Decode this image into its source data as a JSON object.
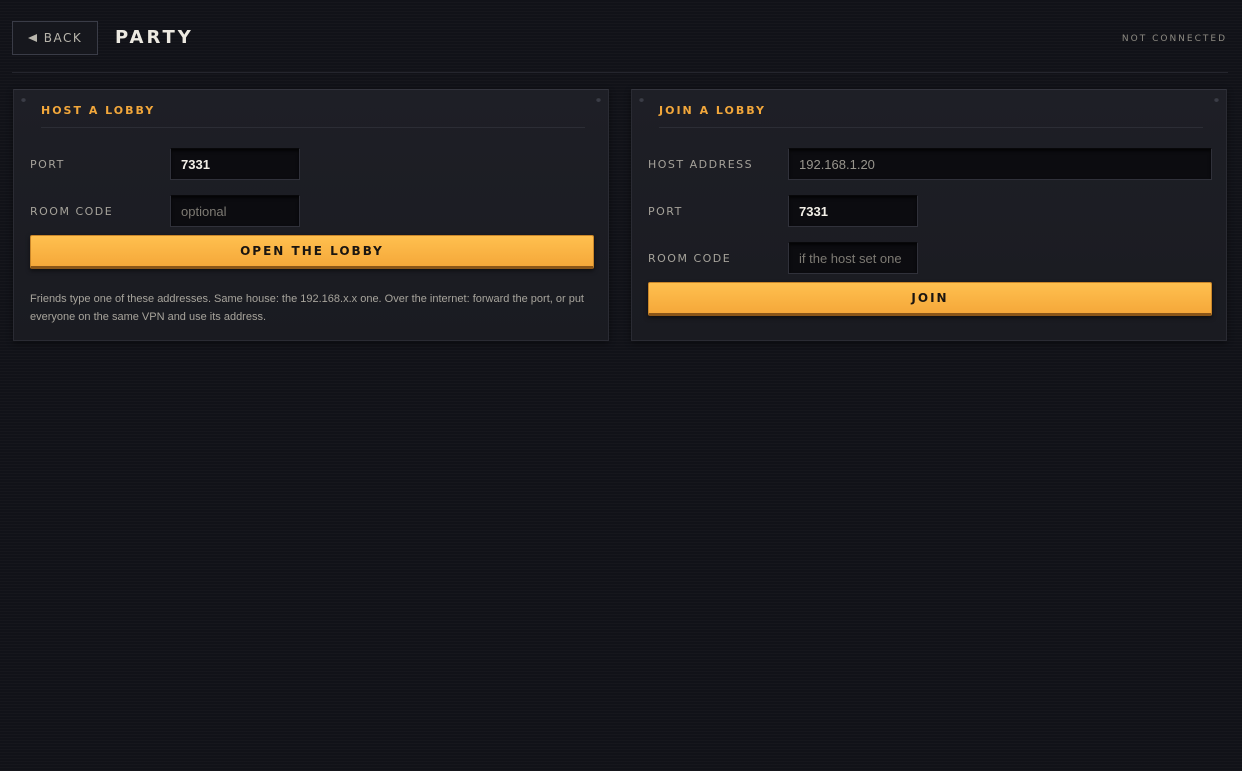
{
  "header": {
    "back_label": "BACK",
    "title": "PARTY",
    "status": "NOT CONNECTED"
  },
  "host_panel": {
    "title": "HOST A LOBBY",
    "port_label": "PORT",
    "port_value": "7331",
    "room_code_label": "ROOM CODE",
    "room_code_value": "",
    "room_code_placeholder": "optional",
    "button_label": "OPEN THE LOBBY",
    "help_text": "Friends type one of these addresses. Same house: the 192.168.x.x one. Over the internet: forward the port, or put everyone on the same VPN and use its address."
  },
  "join_panel": {
    "title": "JOIN A LOBBY",
    "host_address_label": "HOST ADDRESS",
    "host_address_value": "192.168.1.20",
    "port_label": "PORT",
    "port_value": "7331",
    "room_code_label": "ROOM CODE",
    "room_code_value": "",
    "room_code_placeholder": "if the host set one",
    "button_label": "JOIN"
  },
  "colors": {
    "accent": "#f2a73b",
    "button": "#ffb545",
    "background": "#111218",
    "panel": "#1c1d23"
  },
  "icons": {
    "back": "back-arrow-icon"
  }
}
